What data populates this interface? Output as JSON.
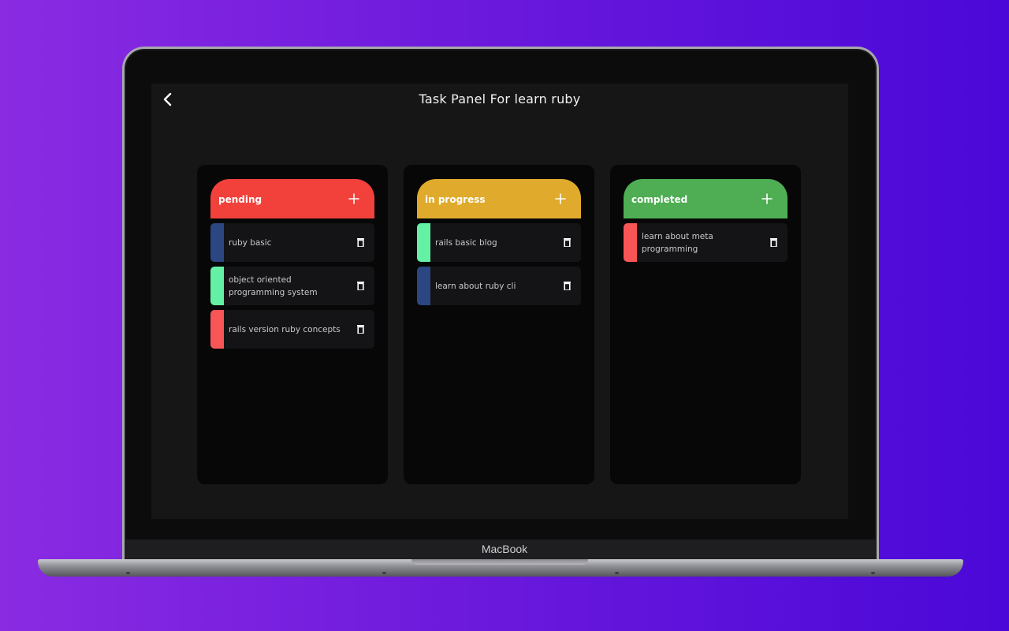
{
  "device": {
    "brand_label": "MacBook"
  },
  "app": {
    "title": "Task Panel For learn ruby",
    "back_icon": "chevron-left-icon"
  },
  "colors": {
    "pending": "#f2413b",
    "in_progress": "#e0ab2c",
    "completed": "#4fad53",
    "bar_blue": "#2b4680",
    "bar_green": "#64f0a5",
    "bar_red": "#f75556"
  },
  "columns": [
    {
      "title": "pending",
      "tasks": [
        {
          "text": "ruby basic",
          "bar": "#2b4680"
        },
        {
          "text": "object oriented programming system",
          "bar": "#64f0a5"
        },
        {
          "text": "rails version ruby concepts",
          "bar": "#f75556"
        }
      ]
    },
    {
      "title": "in progress",
      "tasks": [
        {
          "text": "rails basic blog",
          "bar": "#64f0a5"
        },
        {
          "text": "learn about ruby cli",
          "bar": "#2b4680"
        }
      ]
    },
    {
      "title": "completed",
      "tasks": [
        {
          "text": "learn about meta programming",
          "bar": "#f75556"
        }
      ]
    }
  ]
}
